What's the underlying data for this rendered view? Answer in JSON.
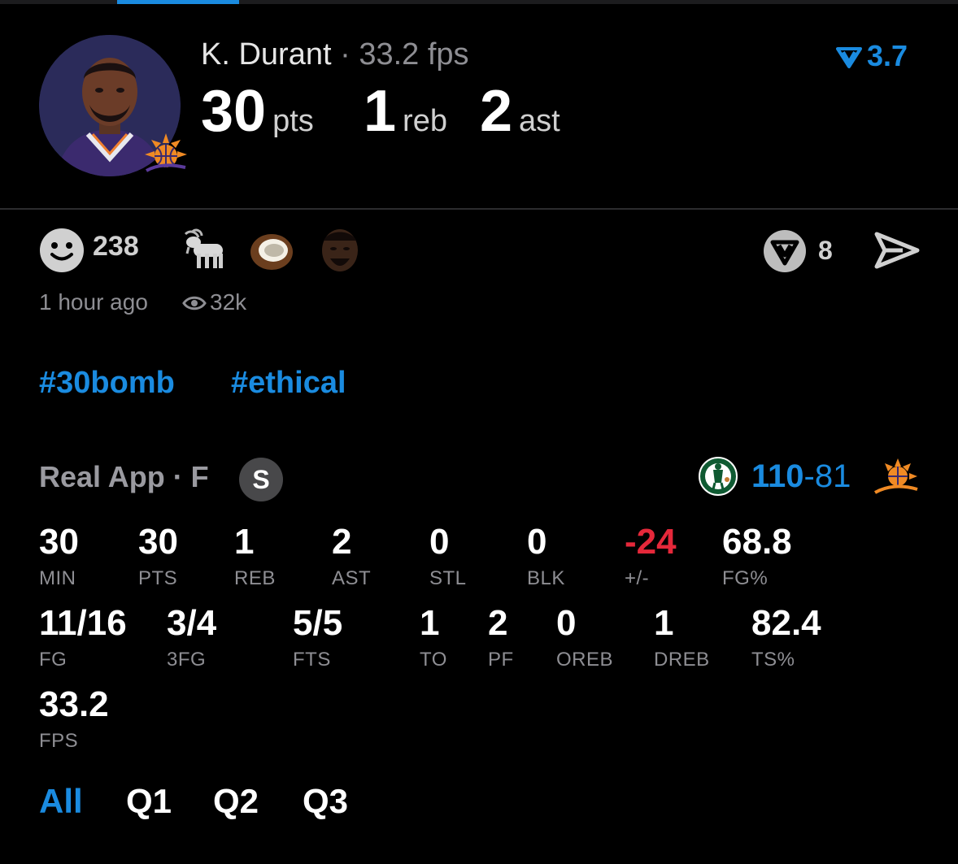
{
  "header": {
    "player_name": "K. Durant",
    "separator": "·",
    "fps_summary": "33.2 fps",
    "rating": "3.7",
    "stats": [
      {
        "value": "30",
        "unit": "pts"
      },
      {
        "value": "1",
        "unit": "reb"
      },
      {
        "value": "2",
        "unit": "ast"
      }
    ]
  },
  "reactions": {
    "count": "238",
    "emoji_names": [
      "goat-emoji",
      "coconut-emoji",
      "player-face-emoji"
    ],
    "comment_count": "8"
  },
  "meta": {
    "time": "1 hour ago",
    "views": "32k"
  },
  "tags": [
    "#30bomb",
    "#ethical"
  ],
  "game": {
    "title": "Real App · F",
    "badge": "S",
    "score_home": "110",
    "score_dash": "-",
    "score_away": "81"
  },
  "stats_rows": [
    [
      {
        "value": "30",
        "label": "MIN"
      },
      {
        "value": "30",
        "label": "PTS"
      },
      {
        "value": "1",
        "label": "REB"
      },
      {
        "value": "2",
        "label": "AST"
      },
      {
        "value": "0",
        "label": "STL"
      },
      {
        "value": "0",
        "label": "BLK"
      },
      {
        "value": "-24",
        "label": "+/-"
      },
      {
        "value": "68.8",
        "label": "FG%"
      }
    ],
    [
      {
        "value": "11/16",
        "label": "FG"
      },
      {
        "value": "3/4",
        "label": "3FG"
      },
      {
        "value": "5/5",
        "label": "FTS"
      },
      {
        "value": "1",
        "label": "TO"
      },
      {
        "value": "2",
        "label": "PF"
      },
      {
        "value": "0",
        "label": "OREB"
      },
      {
        "value": "1",
        "label": "DREB"
      },
      {
        "value": "82.4",
        "label": "TS%"
      }
    ],
    [
      {
        "value": "33.2",
        "label": "FPS"
      }
    ]
  ],
  "quarter_tabs": [
    "All",
    "Q1",
    "Q2",
    "Q3"
  ],
  "colors": {
    "accent": "#1a8be0",
    "negative": "#e5283a",
    "muted": "#8e8e93"
  }
}
